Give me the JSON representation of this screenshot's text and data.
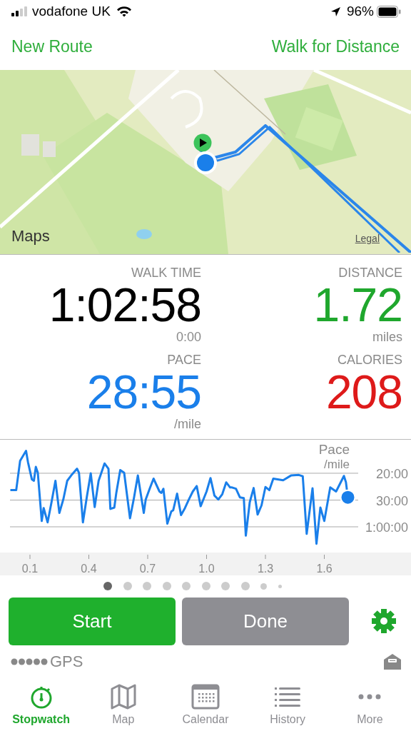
{
  "status_bar": {
    "carrier": "vodafone UK",
    "battery": "96%"
  },
  "nav": {
    "left": "New Route",
    "right": "Walk for Distance"
  },
  "map": {
    "logo": "Maps",
    "legal": "Legal"
  },
  "stats": [
    {
      "label": "WALK TIME",
      "value": "1:02:58",
      "sub": "0:00",
      "color": "#000000"
    },
    {
      "label": "DISTANCE",
      "value": "1.72",
      "sub": "miles",
      "color": "#1fa72d"
    },
    {
      "label": "PACE",
      "value": "28:55",
      "sub": "/mile",
      "color": "#1a7fea"
    },
    {
      "label": "CALORIES",
      "value": "208",
      "color": "#de1a1a"
    }
  ],
  "chart": {
    "title": "Pace",
    "unit": "/mile",
    "y_labels": [
      "20:00",
      "30:00",
      "1:00:00"
    ],
    "x_labels": [
      "0.1",
      "0.4",
      "0.7",
      "1.0",
      "1.3",
      "1.6"
    ]
  },
  "pages": [
    {
      "selected": true
    },
    {
      "selected": false
    },
    {
      "selected": false
    },
    {
      "selected": false
    },
    {
      "selected": false
    },
    {
      "selected": false
    },
    {
      "selected": false
    },
    {
      "selected": false
    },
    {
      "selected": false
    },
    {
      "selected": false
    }
  ],
  "buttons": [
    {
      "kind": "primary",
      "label": "Start"
    },
    {
      "kind": "secondary",
      "label": "Done"
    }
  ],
  "gps": {
    "label": "GPS"
  },
  "tabs": [
    {
      "label": "Stopwatch",
      "selected": true
    },
    {
      "label": "Map",
      "selected": false
    },
    {
      "label": "Calendar",
      "selected": false
    },
    {
      "label": "History",
      "selected": false
    },
    {
      "label": "More",
      "selected": false
    }
  ]
}
